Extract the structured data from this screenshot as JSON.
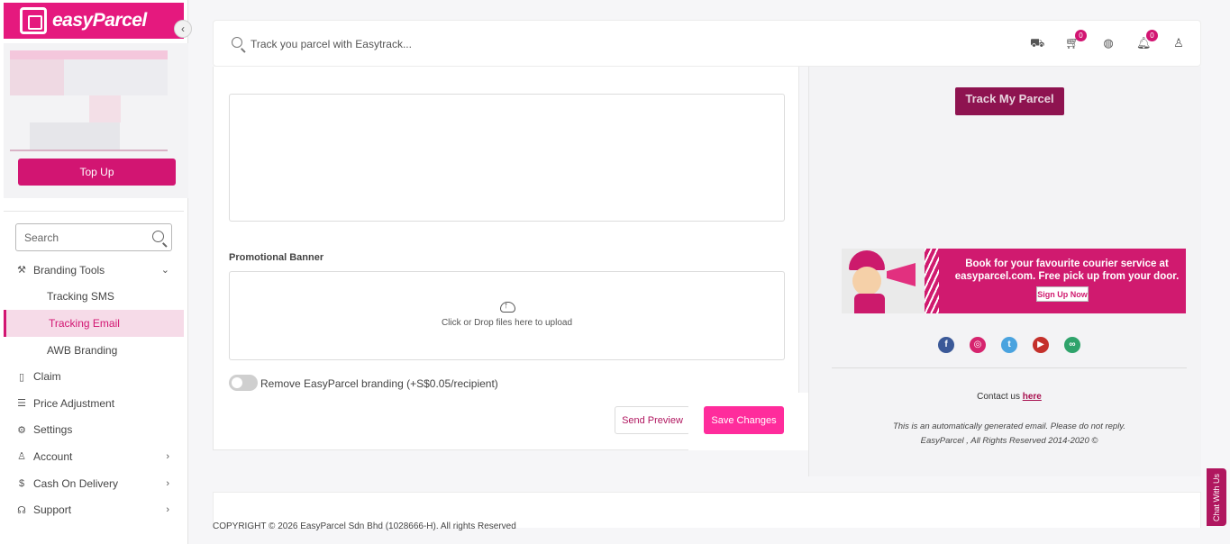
{
  "brand": {
    "logo_text": "easyParcel",
    "accent": "#e5197e"
  },
  "sidebar": {
    "topup_label": "Top Up",
    "search_placeholder": "Search",
    "items": [
      {
        "label": "Branding Tools",
        "icon": "wrench-icon",
        "expanded": true
      },
      {
        "label": "Tracking SMS",
        "sub": true
      },
      {
        "label": "Tracking Email",
        "sub": true,
        "active": true
      },
      {
        "label": "AWB Branding",
        "sub": true
      },
      {
        "label": "Claim",
        "icon": "document-icon"
      },
      {
        "label": "Price Adjustment",
        "icon": "sliders-icon"
      },
      {
        "label": "Settings",
        "icon": "gear-icon"
      },
      {
        "label": "Account",
        "icon": "user-icon",
        "chevron": true
      },
      {
        "label": "Cash On Delivery",
        "icon": "dollar-icon",
        "chevron": true
      },
      {
        "label": "Support",
        "icon": "headset-icon",
        "chevron": true
      }
    ]
  },
  "topbar": {
    "track_placeholder": "Track you parcel with Easytrack...",
    "cart_count": "0",
    "notification_count": "0"
  },
  "form": {
    "promo_label": "Promotional Banner",
    "drop_text": "Click or Drop files here to upload",
    "toggle_label": "Remove EasyParcel branding (+S$0.05/recipient)",
    "toggle_on": false,
    "send_preview_label": "Send Preview",
    "save_label": "Save Changes"
  },
  "preview": {
    "track_button": "Track My Parcel",
    "promo_text": "Book for your favourite courier service at easyparcel.com. Free pick up from your door.",
    "promo_button": "Sign Up Now",
    "contact_prefix": "Contact us ",
    "contact_link": "here",
    "auto_note": "This is an automatically generated email. Please do not reply.",
    "rights": "EasyParcel , All Rights Reserved 2014-2020 ©"
  },
  "footer": {
    "copyright": "COPYRIGHT © 2026 EasyParcel Sdn Bhd (1028666-H). All rights Reserved"
  },
  "chat": {
    "label": "Chat With Us"
  }
}
